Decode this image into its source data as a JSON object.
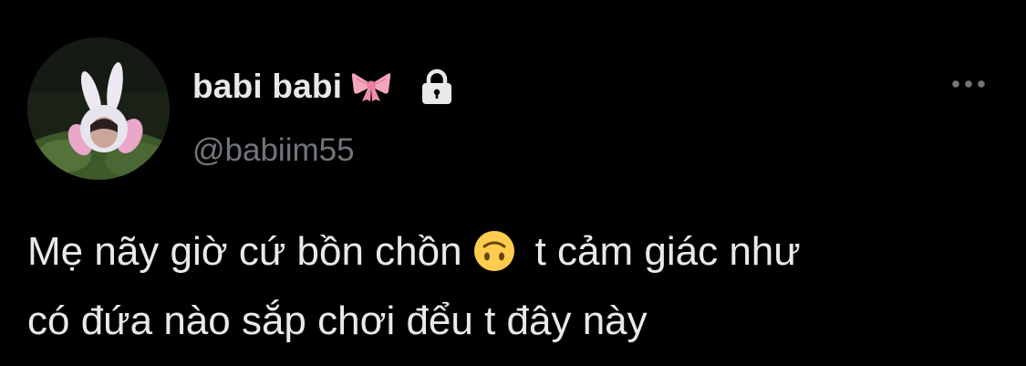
{
  "tweet": {
    "author": {
      "display_name": "babi babi",
      "handle": "@babiim55",
      "badge_emoji": "ribbon-bow-emoji",
      "protected_icon": "lock-icon"
    },
    "more_icon": "more-horizontal-icon",
    "text": {
      "line1_before_emoji": "Mẹ nãy giờ cứ bồn chồn",
      "emoji": "upside-down-face-emoji",
      "line1_after_emoji": "t cảm giác như",
      "line2": "có đứa nào sắp chơi đểu t đây này"
    }
  },
  "colors": {
    "background": "#000000",
    "primary_text": "#e7e9ea",
    "secondary_text": "#71767b",
    "bow_pink": "#f4a7bb",
    "emoji_yellow": "#ffcc4d"
  }
}
